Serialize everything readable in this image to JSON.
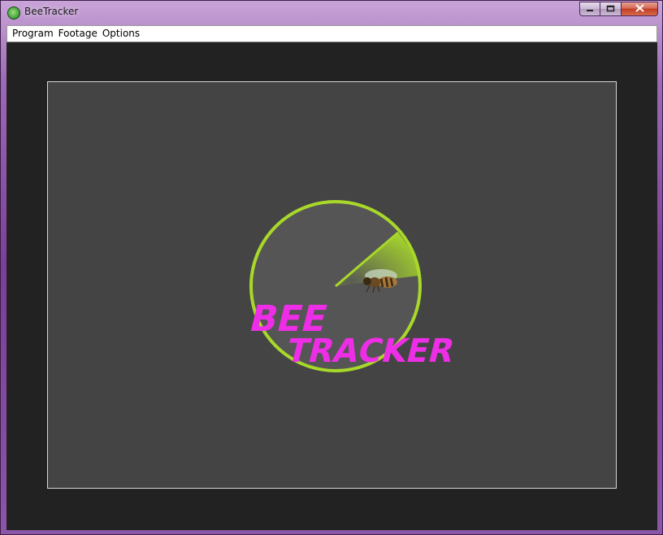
{
  "window": {
    "title": "BeeTracker",
    "icon": "app-bee-icon",
    "controls": {
      "minimize": "minimize-icon",
      "maximize": "maximize-icon",
      "close": "close-icon"
    }
  },
  "menubar": {
    "items": [
      {
        "label": "Program"
      },
      {
        "label": "Footage"
      },
      {
        "label": "Options"
      }
    ]
  },
  "logo": {
    "line1": "BEE",
    "line2": "TRACKER",
    "text_color": "#ee2ee6",
    "ring_color": "#a8d82a"
  },
  "colors": {
    "client_bg": "#222222",
    "canvas_bg": "#444444"
  }
}
